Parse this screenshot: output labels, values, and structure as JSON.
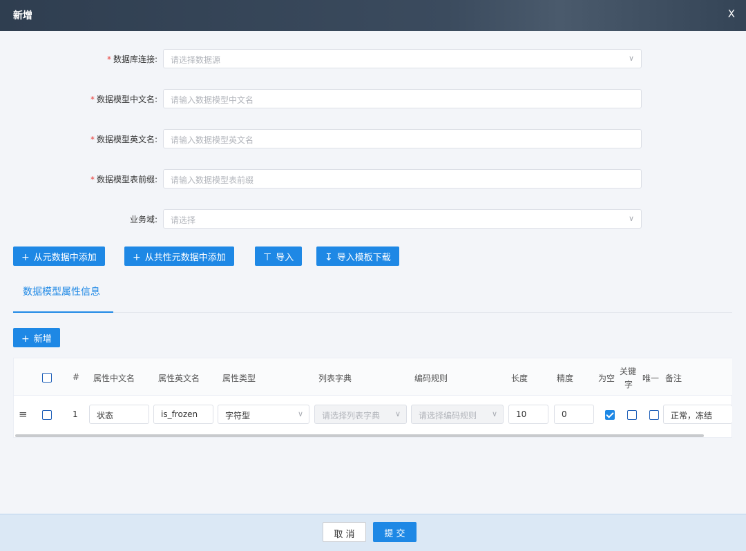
{
  "dialog": {
    "title": "新增",
    "close_label": "X"
  },
  "form": {
    "required_mark": "*",
    "datasource": {
      "label": "数据库连接:",
      "placeholder": "请选择数据源"
    },
    "model_cn_name": {
      "label": "数据模型中文名:",
      "placeholder": "请输入数据模型中文名"
    },
    "model_en_name": {
      "label": "数据模型英文名:",
      "placeholder": "请输入数据模型英文名"
    },
    "table_prefix": {
      "label": "数据模型表前缀:",
      "placeholder": "请输入数据模型表前缀"
    },
    "business_domain": {
      "label": "业务域:",
      "placeholder": "请选择"
    }
  },
  "toolbar": {
    "add_from_metadata": "从元数据中添加",
    "add_from_shared_metadata": "从共性元数据中添加",
    "import": "导入",
    "download_template": "导入模板下载"
  },
  "tabs": {
    "attributes": "数据模型属性信息"
  },
  "add_button": "新增",
  "table": {
    "headers": {
      "index": "#",
      "cn_name": "属性中文名",
      "en_name": "属性英文名",
      "type": "属性类型",
      "dict": "列表字典",
      "encoding": "编码规则",
      "length": "长度",
      "precision": "精度",
      "nullable": "为空",
      "key_line1": "关键",
      "key_line2": "字",
      "unique": "唯一",
      "remark": "备注"
    },
    "rows": [
      {
        "index": "1",
        "cn_name": "状态",
        "en_name": "is_frozen",
        "type": "字符型",
        "dict_placeholder": "请选择列表字典",
        "encoding_placeholder": "请选择编码规则",
        "length": "10",
        "precision": "0",
        "nullable": true,
        "key": false,
        "unique": false,
        "remark": "正常，冻结"
      }
    ]
  },
  "footer": {
    "cancel": "取 消",
    "submit": "提 交"
  },
  "colors": {
    "primary": "#1e88e5",
    "header_bg": "#2f3e50",
    "required": "#e8413c"
  }
}
